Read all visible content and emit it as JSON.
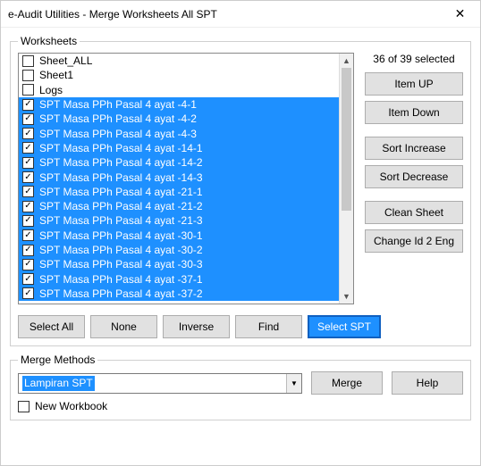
{
  "window": {
    "title": "e-Audit Utilities - Merge Worksheets All SPT"
  },
  "worksheets": {
    "legend": "Worksheets",
    "status": "36 of 39 selected",
    "items": [
      {
        "label": "Sheet_ALL",
        "checked": false,
        "selected": false
      },
      {
        "label": "Sheet1",
        "checked": false,
        "selected": false
      },
      {
        "label": "Logs",
        "checked": false,
        "selected": false
      },
      {
        "label": "SPT Masa PPh Pasal 4 ayat -4-1",
        "checked": true,
        "selected": true
      },
      {
        "label": "SPT Masa PPh Pasal 4 ayat -4-2",
        "checked": true,
        "selected": true
      },
      {
        "label": "SPT Masa PPh Pasal 4 ayat -4-3",
        "checked": true,
        "selected": true
      },
      {
        "label": "SPT Masa PPh Pasal 4 ayat -14-1",
        "checked": true,
        "selected": true
      },
      {
        "label": "SPT Masa PPh Pasal 4 ayat -14-2",
        "checked": true,
        "selected": true
      },
      {
        "label": "SPT Masa PPh Pasal 4 ayat -14-3",
        "checked": true,
        "selected": true
      },
      {
        "label": "SPT Masa PPh Pasal 4 ayat -21-1",
        "checked": true,
        "selected": true
      },
      {
        "label": "SPT Masa PPh Pasal 4 ayat -21-2",
        "checked": true,
        "selected": true
      },
      {
        "label": "SPT Masa PPh Pasal 4 ayat -21-3",
        "checked": true,
        "selected": true
      },
      {
        "label": "SPT Masa PPh Pasal 4 ayat -30-1",
        "checked": true,
        "selected": true
      },
      {
        "label": "SPT Masa PPh Pasal 4 ayat -30-2",
        "checked": true,
        "selected": true
      },
      {
        "label": "SPT Masa PPh Pasal 4 ayat -30-3",
        "checked": true,
        "selected": true
      },
      {
        "label": "SPT Masa PPh Pasal 4 ayat -37-1",
        "checked": true,
        "selected": true
      },
      {
        "label": "SPT Masa PPh Pasal 4 ayat -37-2",
        "checked": true,
        "selected": true
      }
    ],
    "side_buttons": {
      "item_up": "Item UP",
      "item_down": "Item Down",
      "sort_increase": "Sort Increase",
      "sort_decrease": "Sort Decrease",
      "clean_sheet": "Clean Sheet",
      "change_id": "Change Id 2 Eng"
    },
    "bottom_buttons": {
      "select_all": "Select All",
      "none": "None",
      "inverse": "Inverse",
      "find": "Find",
      "select_spt": "Select SPT"
    }
  },
  "merge": {
    "legend": "Merge Methods",
    "selected": "Lampiran SPT",
    "merge_btn": "Merge",
    "help_btn": "Help",
    "new_workbook": "New Workbook"
  }
}
